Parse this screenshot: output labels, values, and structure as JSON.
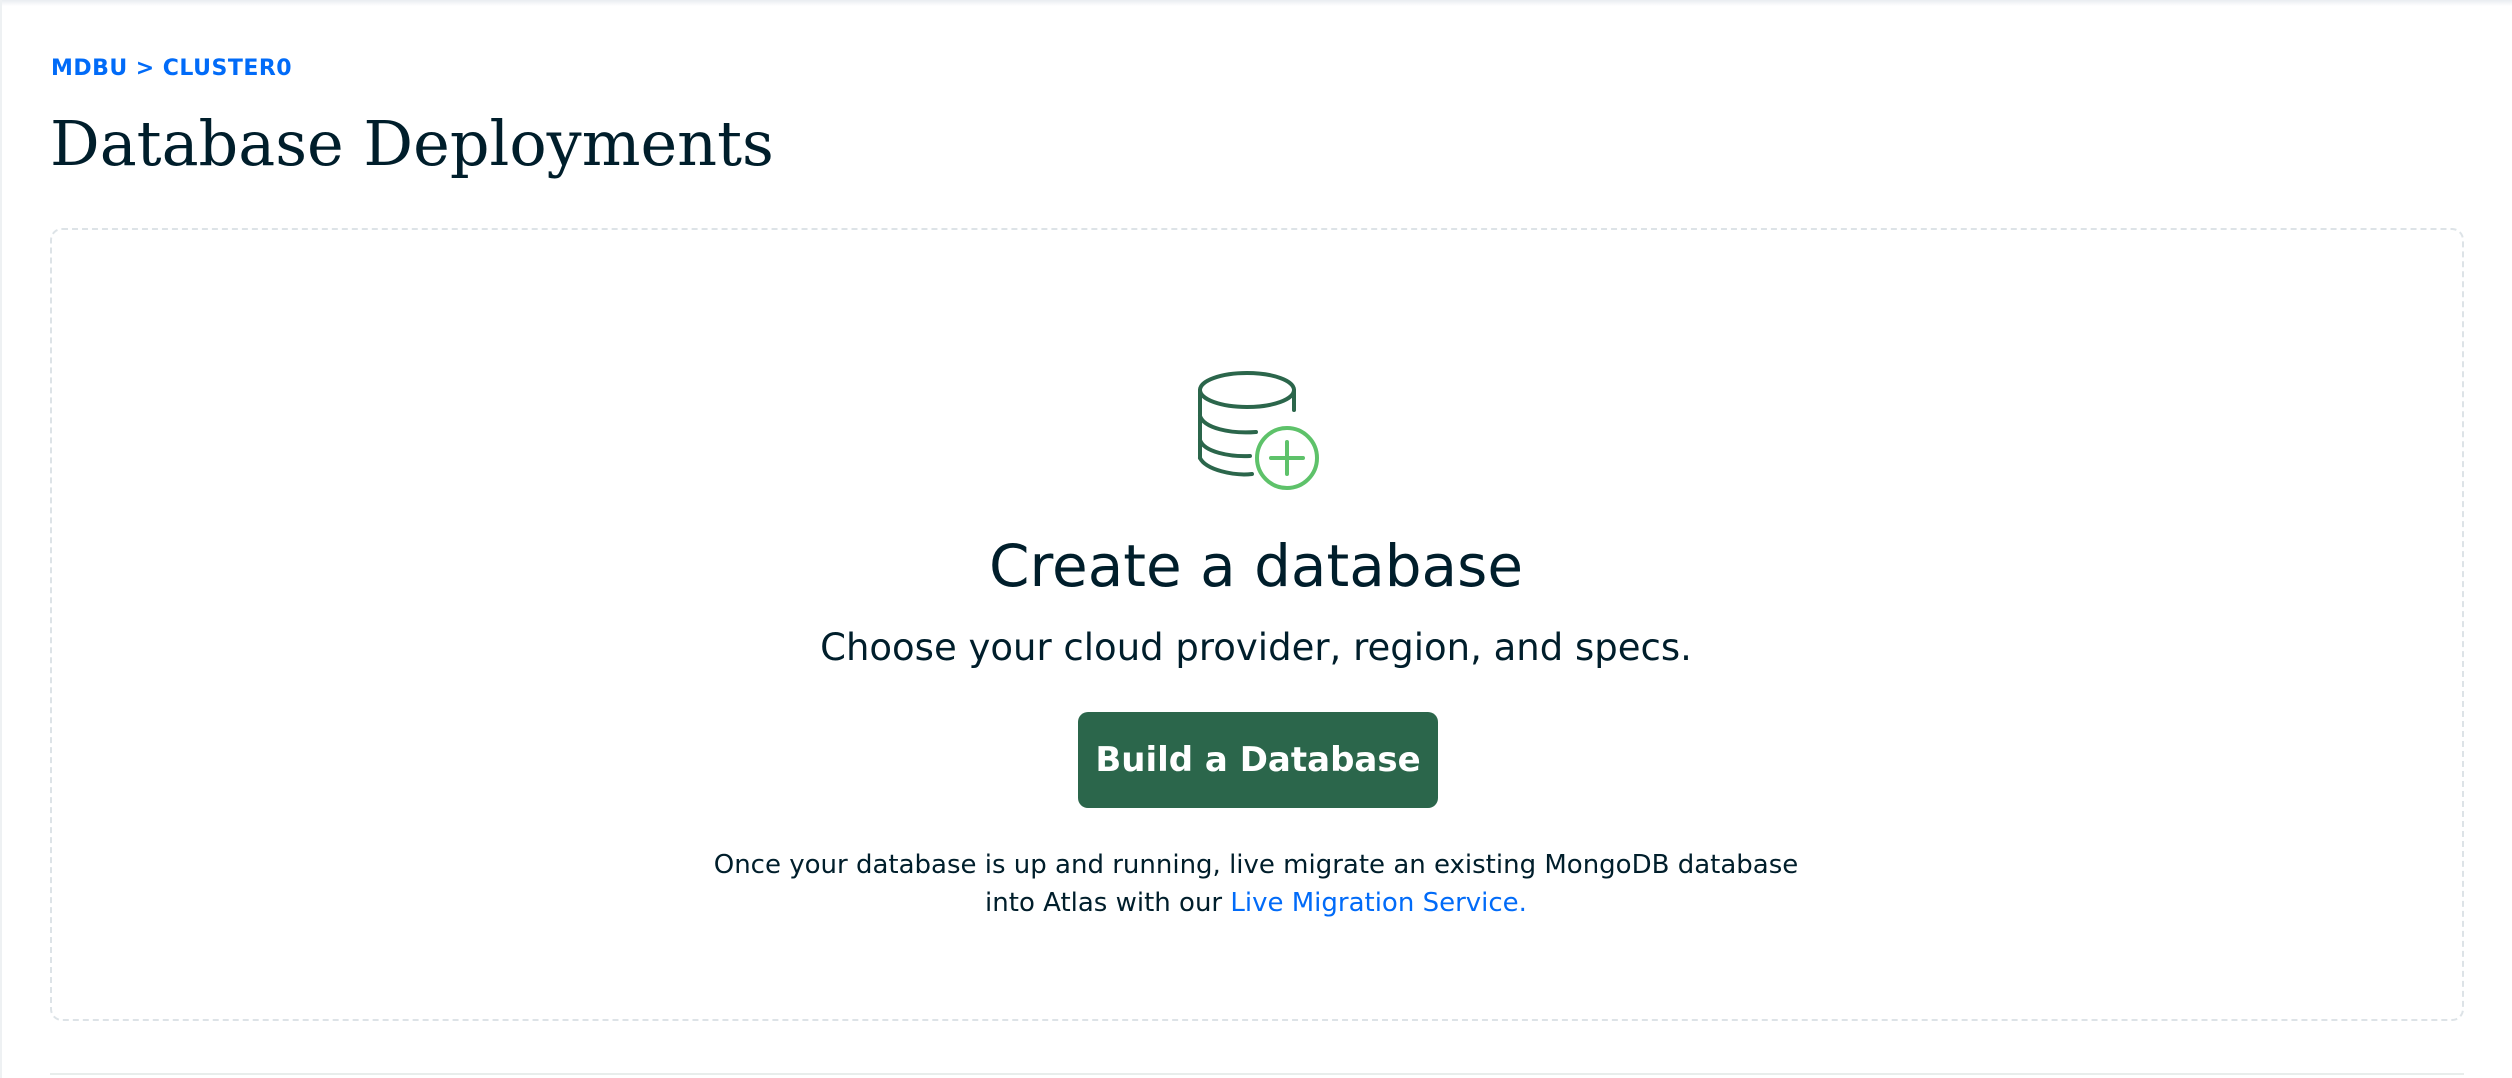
{
  "breadcrumb": {
    "items": [
      "MDBU",
      "CLUSTER0"
    ],
    "separator": ">"
  },
  "page": {
    "title": "Database Deployments"
  },
  "empty_state": {
    "icon": "database-add-icon",
    "heading": "Create a database",
    "subheading": "Choose your cloud provider, region, and specs.",
    "button_label": "Build a Database",
    "note_line1": "Once your database is up and running, live migrate an existing MongoDB database",
    "note_line2_prefix": "into Atlas with our ",
    "note_link": "Live Migration Service."
  },
  "colors": {
    "link": "#016bf8",
    "primary_button": "#2b664b",
    "icon_dark_green": "#2b664b",
    "icon_light_green": "#5ec26a",
    "text": "#001e2b"
  }
}
